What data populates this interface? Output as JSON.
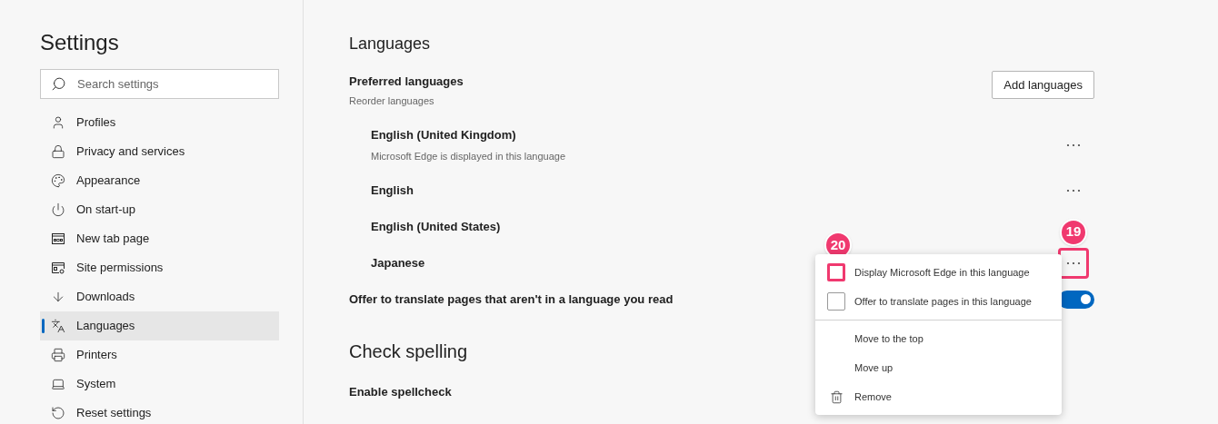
{
  "sidebar": {
    "title": "Settings",
    "search": {
      "placeholder": "Search settings"
    },
    "items": [
      {
        "label": "Profiles",
        "selected": false
      },
      {
        "label": "Privacy and services",
        "selected": false
      },
      {
        "label": "Appearance",
        "selected": false
      },
      {
        "label": "On start-up",
        "selected": false
      },
      {
        "label": "New tab page",
        "selected": false
      },
      {
        "label": "Site permissions",
        "selected": false
      },
      {
        "label": "Downloads",
        "selected": false
      },
      {
        "label": "Languages",
        "selected": true
      },
      {
        "label": "Printers",
        "selected": false
      },
      {
        "label": "System",
        "selected": false
      },
      {
        "label": "Reset settings",
        "selected": false
      }
    ]
  },
  "languages": {
    "title": "Languages",
    "preferred": {
      "label": "Preferred languages",
      "hint": "Reorder languages",
      "button": "Add languages"
    },
    "rows": [
      {
        "name": "English (United Kingdom)",
        "subtitle": "Microsoft Edge is displayed in this language",
        "more_button": true
      },
      {
        "name": "English",
        "more_button": true
      },
      {
        "name": "English (United States)",
        "more_button": false
      },
      {
        "name": "Japanese",
        "more_button": true,
        "callout": "19"
      }
    ],
    "translate": {
      "label": "Offer to translate pages that aren't in a language you read",
      "on": true
    },
    "context_menu": [
      {
        "kind": "check",
        "label": "Display Microsoft Edge in this language",
        "checked": false,
        "callout": "20"
      },
      {
        "kind": "check",
        "label": "Offer to translate pages in this language",
        "checked": false
      },
      {
        "kind": "action",
        "label": "Move to the top"
      },
      {
        "kind": "action",
        "label": "Move up"
      },
      {
        "kind": "delete",
        "label": "Remove"
      }
    ]
  },
  "spelling": {
    "title": "Check spelling",
    "enable_label": "Enable spellcheck"
  }
}
